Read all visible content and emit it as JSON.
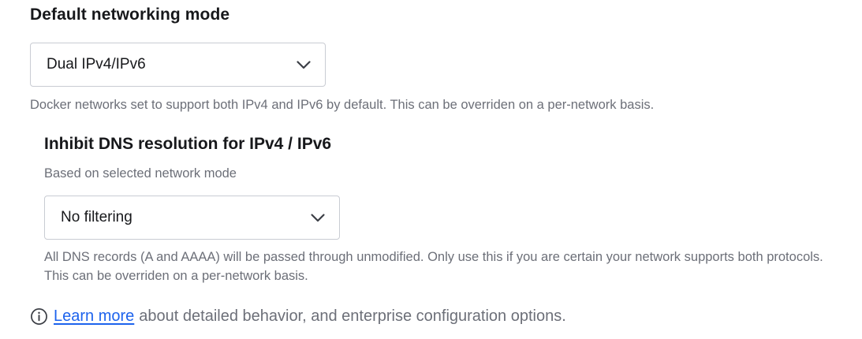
{
  "networking": {
    "title": "Default networking mode",
    "mode_select": {
      "value": "Dual IPv4/IPv6",
      "icon": "chevron-down-icon"
    },
    "help": "Docker networks set to support both IPv4 and IPv6 by default. This can be overriden on a per-network basis."
  },
  "dns": {
    "title": "Inhibit DNS resolution for IPv4 / IPv6",
    "description": "Based on selected network mode",
    "filter_select": {
      "value": "No filtering",
      "icon": "chevron-down-icon"
    },
    "help": "All DNS records (A and AAAA) will be passed through unmodified. Only use this if you are certain your network supports both protocols. This can be overriden on a per-network basis."
  },
  "footer": {
    "icon": "info-icon",
    "link_text": "Learn more",
    "text": "about detailed behavior, and enterprise configuration options."
  },
  "colors": {
    "link": "#1d63ed",
    "text": "#17181b",
    "muted": "#6c6f78",
    "border": "#c9ccd3"
  }
}
